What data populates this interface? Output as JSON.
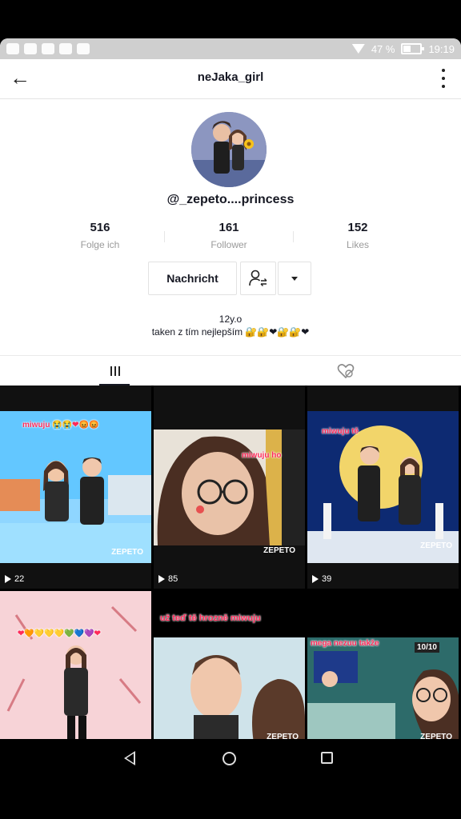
{
  "status_bar": {
    "battery": "47 %",
    "time": "19:19"
  },
  "header": {
    "title": "neJaka_girl"
  },
  "profile": {
    "handle": "@_zepeto....princess",
    "stats": [
      {
        "value": "516",
        "label": "Folge ich"
      },
      {
        "value": "161",
        "label": "Follower"
      },
      {
        "value": "152",
        "label": "Likes"
      }
    ],
    "message_button": "Nachricht",
    "bio_line1": "12y.o",
    "bio_line2": "taken z tím nejlepším 🔐🔐❤🔐🔐❤"
  },
  "videos": [
    {
      "plays": "22",
      "caption": "miwuju 😭😭❤😡😡",
      "badge": "ZEPETO",
      "top_color": "#63c7ff",
      "bottom_color": "#3fa7ef"
    },
    {
      "plays": "85",
      "caption": "miwuju ho",
      "badge": "ZEPETO",
      "top_color": "#2b1d18",
      "bottom_color": "#6a4a35"
    },
    {
      "plays": "39",
      "caption": "miwuju tě",
      "badge": "ZEPETO",
      "top_color": "#0d2a72",
      "bottom_color": "#f2d56a"
    },
    {
      "plays": "",
      "caption": "❤🧡💛💛💛💚💙💜❤",
      "badge": "",
      "top_color": "#f7d3d7",
      "bottom_color": "#f1c6cc"
    },
    {
      "plays": "",
      "caption": "už teď tě hrozně miwuju",
      "badge": "ZEPETO",
      "top_color": "#cfe3ea",
      "bottom_color": "#8fb7c4"
    },
    {
      "plays": "",
      "caption": "mega nezuu takže",
      "badge": "ZEPETO",
      "top_color": "#2d6b6a",
      "bottom_color": "#9ec7c0",
      "top_label": "10/10"
    }
  ]
}
